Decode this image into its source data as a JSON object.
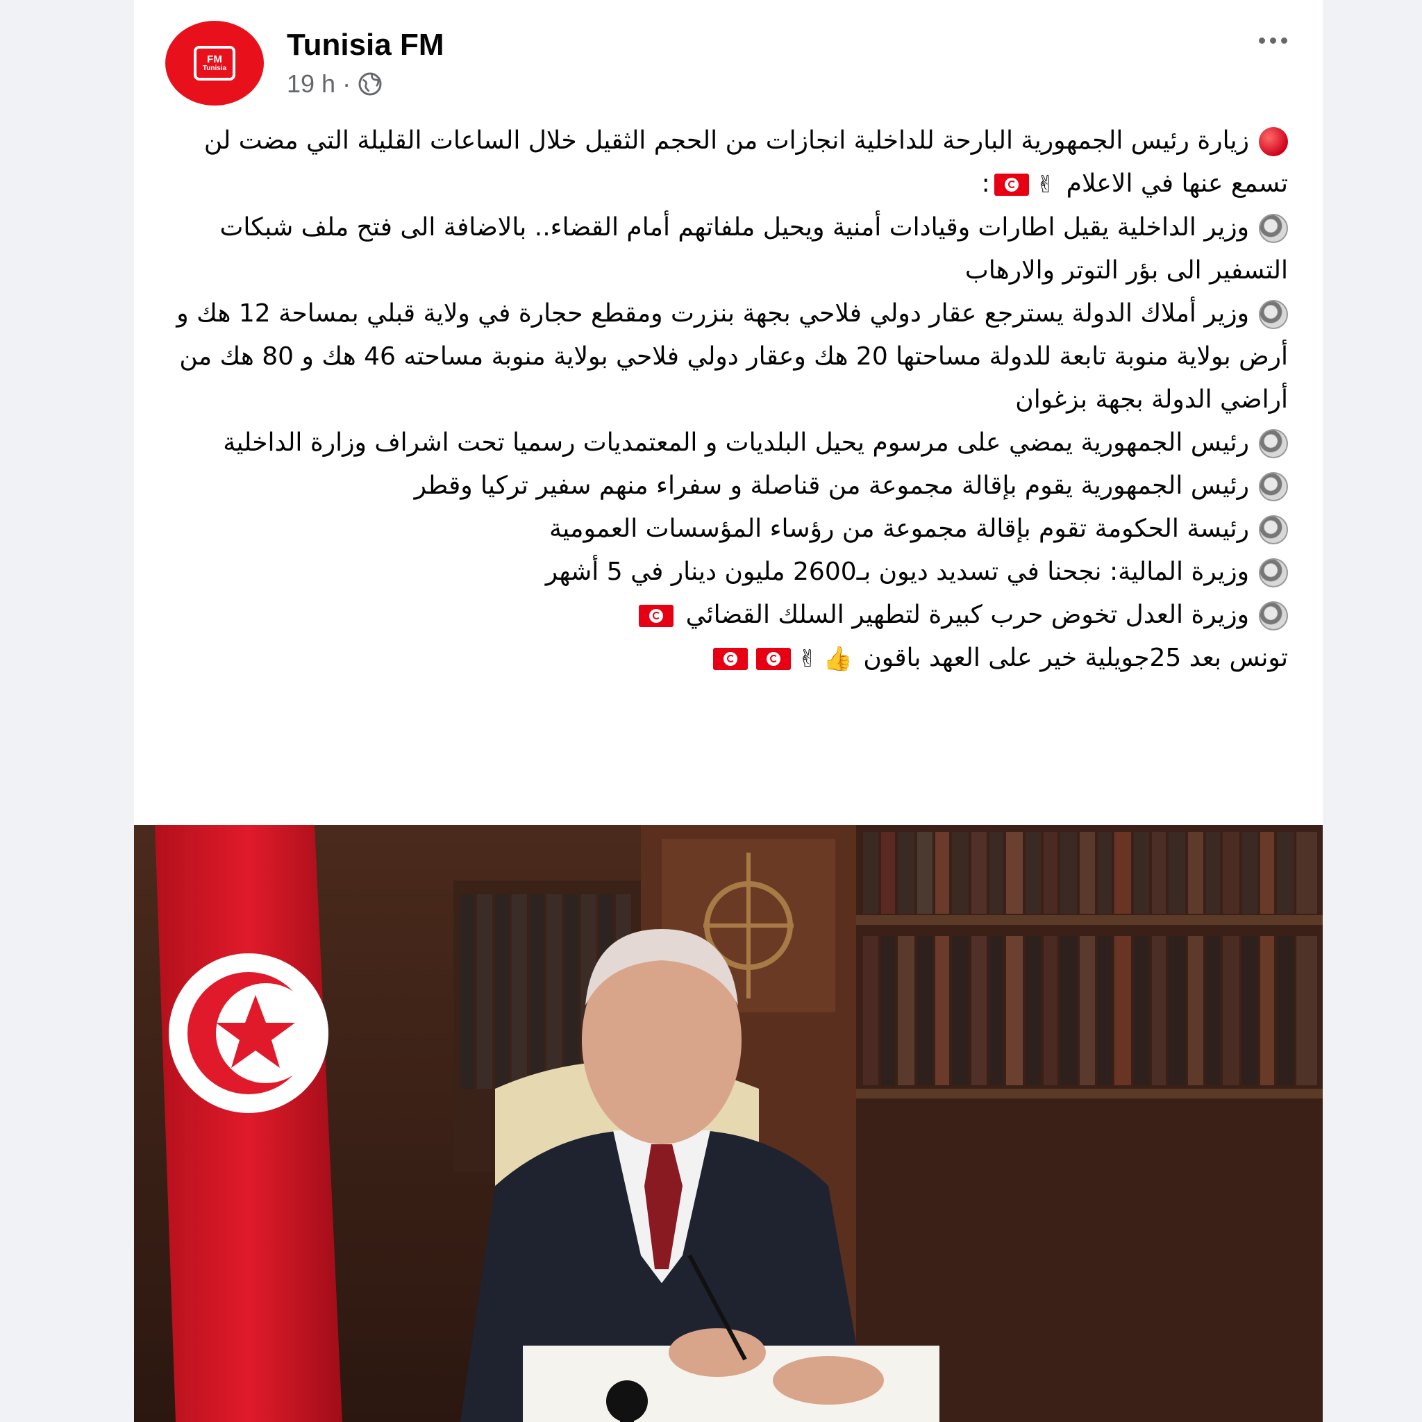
{
  "post": {
    "page_name": "Tunisia FM",
    "avatar_text_top": "FM",
    "avatar_text_bottom": "Tunisia",
    "time": "19 h",
    "separator": "·",
    "intro": "زيارة رئيس الجمهورية البارحة للداخلية انجازات من الحجم الثقيل خلال الساعات القليلة التي مضت لن تسمع عنها في الاعلام",
    "intro_end": ":",
    "items": [
      "وزير الداخلية يقيل اطارات وقيادات أمنية ويحيل ملفاتهم أمام القضاء.. بالاضافة الى فتح ملف شبكات التسفير الى بؤر التوتر والارهاب",
      "وزير أملاك الدولة يسترجع عقار دولي فلاحي بجهة بنزرت ومقطع حجارة في ولاية قبلي بمساحة 12 هك و أرض بولاية منوبة تابعة للدولة مساحتها 20 هك وعقار دولي فلاحي بولاية منوبة مساحته 46 هك و 80 هك من أراضي الدولة بجهة بزغوان",
      "رئيس الجمهورية يمضي على مرسوم يحيل البلديات و المعتمديات رسميا تحت اشراف وزارة الداخلية",
      "رئيس الجمهورية يقوم بإقالة مجموعة من قناصلة و سفراء منهم سفير تركيا وقطر",
      "رئيسة الحكومة تقوم بإقالة مجموعة من رؤساء المؤسسات العمومية",
      "وزيرة المالية: نجحنا في تسديد ديون بـ2600 مليون دينار في 5 أشهر",
      "وزيرة العدل تخوض حرب كبيرة لتطهير السلك القضائي"
    ],
    "closing": "تونس بعد 25جويلية خير على العهد باقون",
    "emoji_victory": "✌",
    "emoji_thumbs": "👍",
    "flag_red": "#e70013",
    "brand_red": "#e8101a"
  }
}
